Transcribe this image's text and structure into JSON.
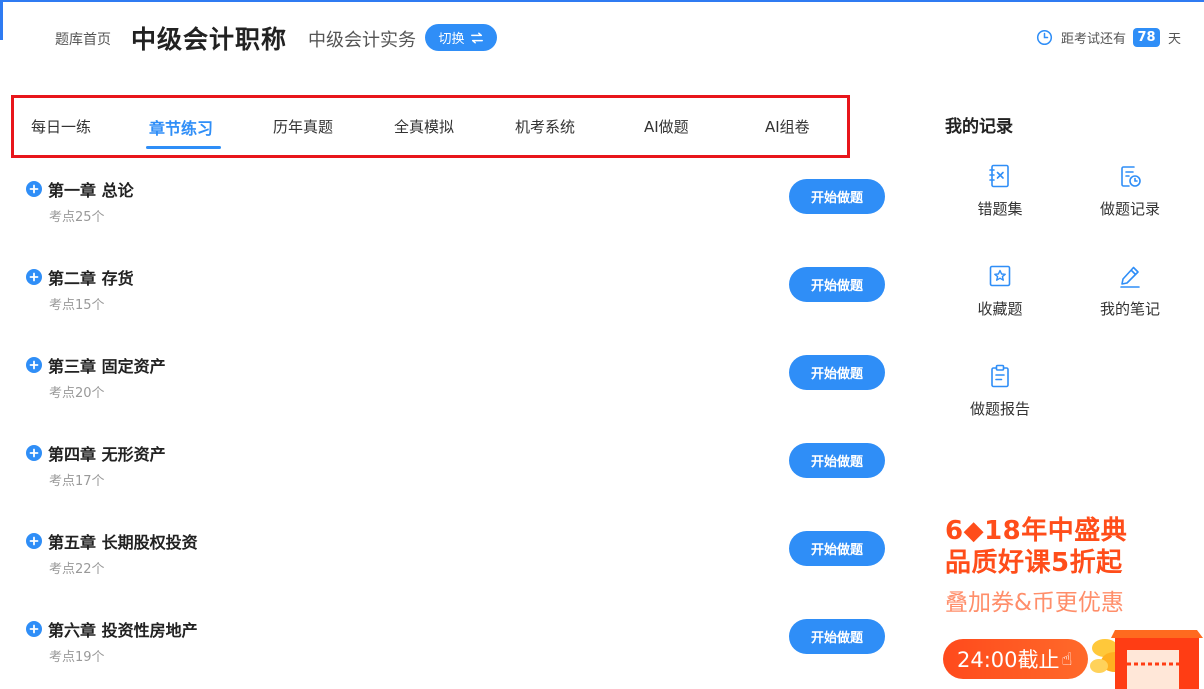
{
  "header": {
    "crumb": "题库首页",
    "title": "中级会计职称",
    "subject": "中级会计实务",
    "switch_label": "切换",
    "exam_prefix": "距考试还有",
    "days": "78",
    "days_unit": "天"
  },
  "tabs": [
    {
      "label": "每日一练",
      "active": false
    },
    {
      "label": "章节练习",
      "active": true
    },
    {
      "label": "历年真题",
      "active": false
    },
    {
      "label": "全真模拟",
      "active": false
    },
    {
      "label": "机考系统",
      "active": false
    },
    {
      "label": "AI做题",
      "active": false
    },
    {
      "label": "AI组卷",
      "active": false
    }
  ],
  "chapters": [
    {
      "title": "第一章 总论",
      "points": "考点25个",
      "button": "开始做题"
    },
    {
      "title": "第二章 存货",
      "points": "考点15个",
      "button": "开始做题"
    },
    {
      "title": "第三章 固定资产",
      "points": "考点20个",
      "button": "开始做题"
    },
    {
      "title": "第四章 无形资产",
      "points": "考点17个",
      "button": "开始做题"
    },
    {
      "title": "第五章 长期股权投资",
      "points": "考点22个",
      "button": "开始做题"
    },
    {
      "title": "第六章 投资性房地产",
      "points": "考点19个",
      "button": "开始做题"
    }
  ],
  "records": {
    "title": "我的记录",
    "items": [
      {
        "label": "错题集",
        "icon": "wrong-book-icon"
      },
      {
        "label": "做题记录",
        "icon": "history-icon"
      },
      {
        "label": "收藏题",
        "icon": "star-icon"
      },
      {
        "label": "我的笔记",
        "icon": "pen-icon"
      },
      {
        "label": "做题报告",
        "icon": "clipboard-icon"
      }
    ]
  },
  "promo": {
    "line1": "6◆18年中盛典",
    "line2": "品质好课5折起",
    "line3": "叠加券&币更优惠",
    "button": "24:00截止"
  },
  "colors": {
    "accent": "#2f8ef7",
    "highlight_box": "#e8161b",
    "promo": "#ff4d1a"
  }
}
